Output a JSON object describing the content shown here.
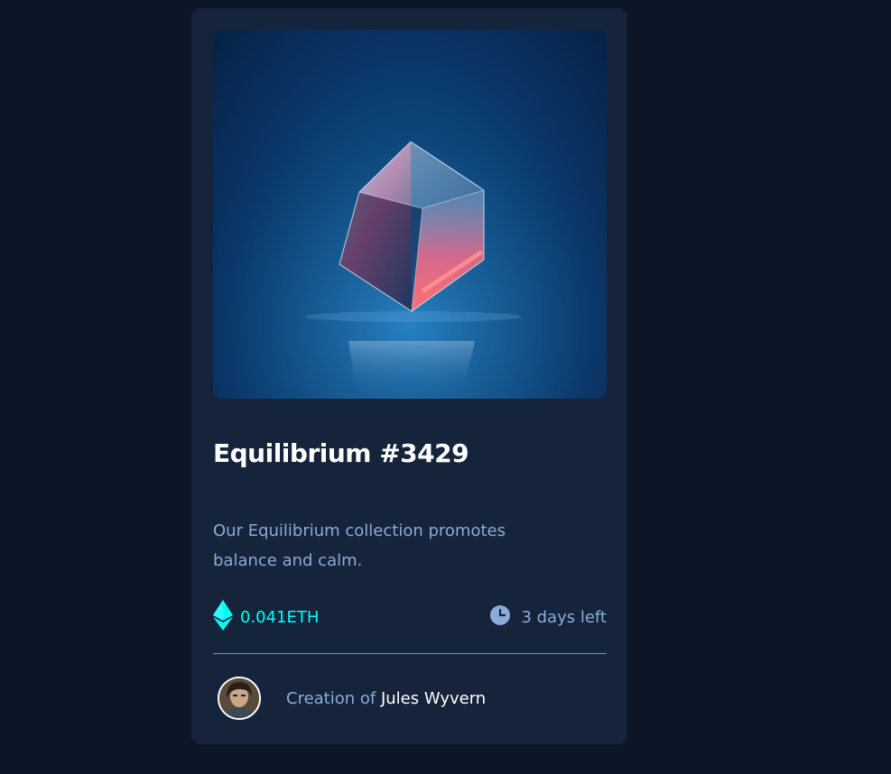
{
  "card": {
    "title": "Equilibrium #3429",
    "description": "Our Equilibrium collection promotes balance and calm.",
    "price": {
      "value": "0.041ETH",
      "icon": "ethereum-icon",
      "color": "#00fff8"
    },
    "time_left": {
      "value": "3 days left",
      "icon": "clock-icon"
    },
    "creator": {
      "prefix": "Creation of ",
      "name": "Jules Wyvern"
    }
  },
  "colors": {
    "background": "#0d1627",
    "card": "#15233b",
    "soft_blue": "#8bacd9",
    "cyan": "#00fff8",
    "white": "#ffffff"
  }
}
